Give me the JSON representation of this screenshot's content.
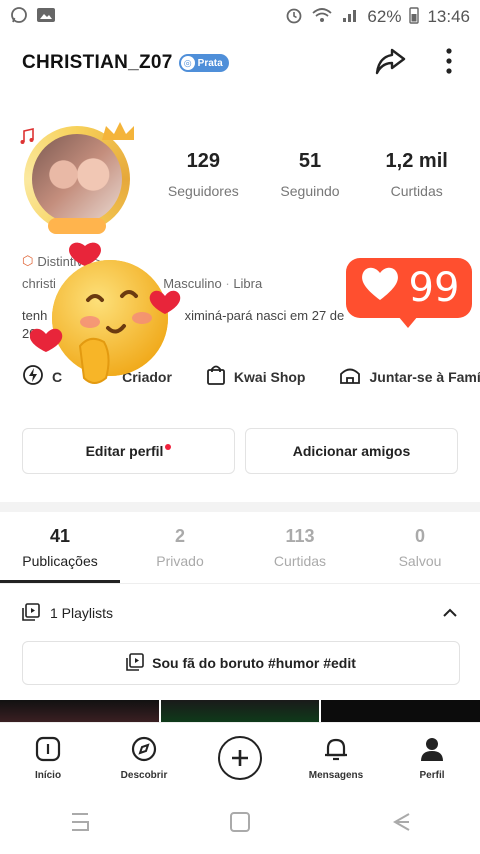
{
  "status_bar": {
    "battery": "62%",
    "time": "13:46",
    "icons": [
      "whatsapp-icon",
      "gallery-icon",
      "alarm-icon",
      "wifi-icon",
      "signal-icon",
      "battery-icon"
    ]
  },
  "header": {
    "username": "CHRISTIAN_Z07",
    "badge": "Prata"
  },
  "stats": [
    {
      "value": "129",
      "label": "Seguidores"
    },
    {
      "value": "51",
      "label": "Seguindo"
    },
    {
      "value": "1,2 mil",
      "label": "Curtidas"
    }
  ],
  "profile": {
    "distinction": "Distintivo >",
    "info_gender": "Masculino",
    "info_sign": "Libra",
    "info_prefix": "christi",
    "bio_visible": "ximiná-pará nasci em 27 de",
    "bio_prefix": "tenh",
    "bio_line2": "20"
  },
  "links": {
    "creator": "Criador",
    "creator_prefix": "C",
    "kwai_shop": "Kwai Shop",
    "family": "Juntar-se à Família"
  },
  "buttons": {
    "edit_profile": "Editar perfil",
    "add_friends": "Adicionar amigos"
  },
  "tabs": [
    {
      "count": "41",
      "label": "Publicações",
      "active": true
    },
    {
      "count": "2",
      "label": "Privado",
      "active": false
    },
    {
      "count": "113",
      "label": "Curtidas",
      "active": false
    },
    {
      "count": "0",
      "label": "Salvou",
      "active": false
    }
  ],
  "playlists": {
    "header": "1 Playlists",
    "item": "Sou fã do boruto #humor #edit"
  },
  "bottom_nav": [
    {
      "label": "Início",
      "icon": "home-icon"
    },
    {
      "label": "Descobrir",
      "icon": "compass-icon"
    },
    {
      "label": "",
      "icon": "plus-icon"
    },
    {
      "label": "Mensagens",
      "icon": "bell-icon"
    },
    {
      "label": "Perfil",
      "icon": "person-icon"
    }
  ],
  "overlay": {
    "likes_count": "99"
  },
  "colors": {
    "accent_red": "#f0223d",
    "like_orange": "#ff4f2f",
    "badge_blue": "#4f8fd9"
  }
}
